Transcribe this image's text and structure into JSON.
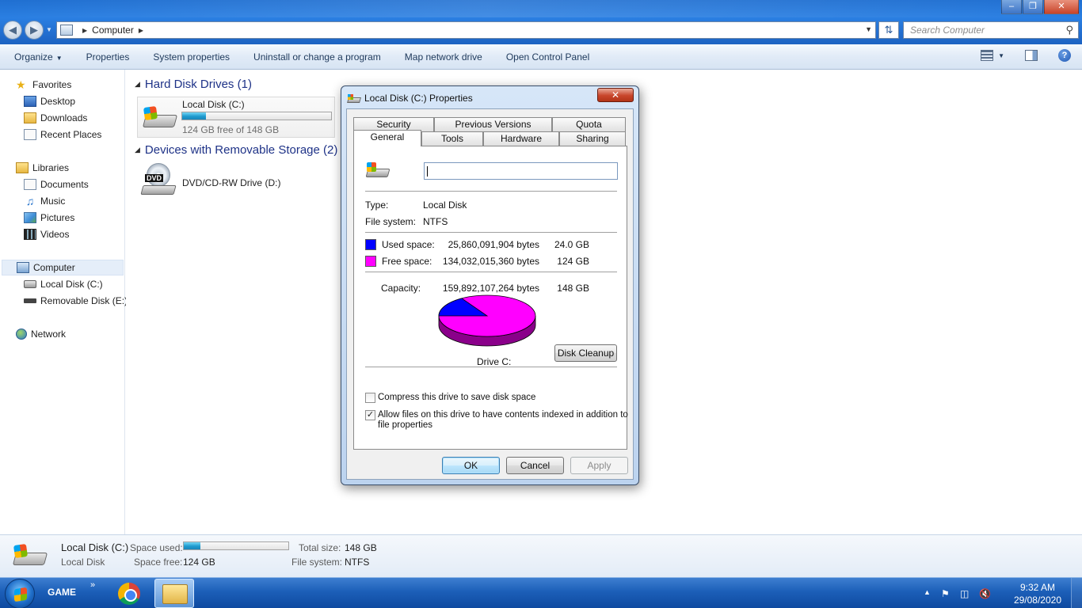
{
  "window": {
    "address_path": "Computer",
    "search_placeholder": "Search Computer"
  },
  "toolbar": {
    "organize": "Organize",
    "properties": "Properties",
    "system_properties": "System properties",
    "uninstall": "Uninstall or change a program",
    "map_drive": "Map network drive",
    "control_panel": "Open Control Panel"
  },
  "sidebar": {
    "favorites": "Favorites",
    "desktop": "Desktop",
    "downloads": "Downloads",
    "recent_places": "Recent Places",
    "libraries": "Libraries",
    "documents": "Documents",
    "music": "Music",
    "pictures": "Pictures",
    "videos": "Videos",
    "computer": "Computer",
    "local_disk": "Local Disk (C:)",
    "removable_disk": "Removable Disk (E:)",
    "network": "Network"
  },
  "main": {
    "hard_disks_header": "Hard Disk Drives (1)",
    "removable_header": "Devices with Removable Storage (2)",
    "local_disk": {
      "name": "Local Disk (C:)",
      "free_text": "124 GB free of 148 GB",
      "used_fraction": 0.162
    },
    "dvd": {
      "name": "DVD/CD-RW Drive (D:)",
      "badge": "DVD"
    }
  },
  "details": {
    "name": "Local Disk (C:)",
    "type": "Local Disk",
    "space_used_label": "Space used:",
    "space_free_label": "Space free:",
    "space_free_value": "124 GB",
    "total_size_label": "Total size:",
    "total_size_value": "148 GB",
    "file_system_label": "File system:",
    "file_system_value": "NTFS",
    "used_fraction": 0.162
  },
  "taskbar": {
    "label": "GAME",
    "time": "9:32 AM",
    "date": "29/08/2020"
  },
  "dialog": {
    "title": "Local Disk (C:) Properties",
    "tabs_row1": [
      "Security",
      "Previous Versions",
      "Quota"
    ],
    "tabs_row2": [
      "General",
      "Tools",
      "Hardware",
      "Sharing"
    ],
    "name_value": "",
    "type_label": "Type:",
    "type_value": "Local Disk",
    "fs_label": "File system:",
    "fs_value": "NTFS",
    "used_label": "Used space:",
    "used_bytes": "25,860,091,904 bytes",
    "used_gb": "24.0 GB",
    "free_label": "Free space:",
    "free_bytes": "134,032,015,360 bytes",
    "free_gb": "124 GB",
    "capacity_label": "Capacity:",
    "capacity_bytes": "159,892,107,264 bytes",
    "capacity_gb": "148 GB",
    "drive_label": "Drive C:",
    "disk_cleanup": "Disk Cleanup",
    "compress_label": "Compress this drive to save disk space",
    "compress_checked": false,
    "index_label_line1": "Allow files on this drive to have contents indexed in addition to",
    "index_label_line2": "file properties",
    "index_checked": true,
    "ok": "OK",
    "cancel": "Cancel",
    "apply": "Apply",
    "colors": {
      "used": "#0000ff",
      "free": "#ff00ff"
    },
    "pie": {
      "used_fraction": 0.162
    }
  }
}
